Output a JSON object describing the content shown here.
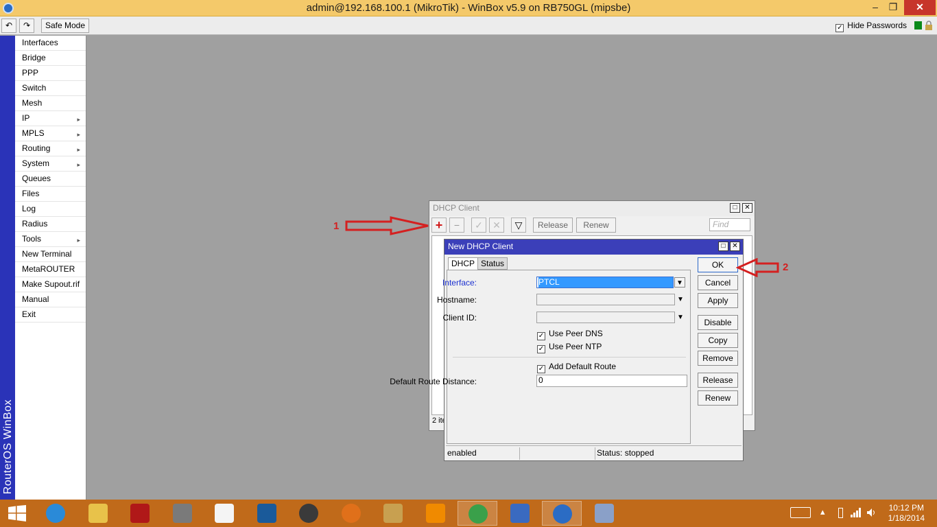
{
  "app": {
    "title": "admin@192.168.100.1 (MikroTik) - WinBox v5.9 on RB750GL (mipsbe)",
    "controls": {
      "minimize": "–",
      "maximize": "❐",
      "close": "✕"
    }
  },
  "toolbar": {
    "undo_glyph": "↶",
    "redo_glyph": "↷",
    "safe_mode": "Safe Mode",
    "hide_passwords": "Hide Passwords",
    "hide_passwords_checked": "✓"
  },
  "sidebar": {
    "vertical_label": "RouterOS WinBox",
    "items": [
      {
        "label": "Interfaces",
        "sub": ""
      },
      {
        "label": "Bridge",
        "sub": ""
      },
      {
        "label": "PPP",
        "sub": ""
      },
      {
        "label": "Switch",
        "sub": ""
      },
      {
        "label": "Mesh",
        "sub": ""
      },
      {
        "label": "IP",
        "sub": "▸"
      },
      {
        "label": "MPLS",
        "sub": "▸"
      },
      {
        "label": "Routing",
        "sub": "▸"
      },
      {
        "label": "System",
        "sub": "▸"
      },
      {
        "label": "Queues",
        "sub": ""
      },
      {
        "label": "Files",
        "sub": ""
      },
      {
        "label": "Log",
        "sub": ""
      },
      {
        "label": "Radius",
        "sub": ""
      },
      {
        "label": "Tools",
        "sub": "▸"
      },
      {
        "label": "New Terminal",
        "sub": ""
      },
      {
        "label": "MetaROUTER",
        "sub": ""
      },
      {
        "label": "Make Supout.rif",
        "sub": ""
      },
      {
        "label": "Manual",
        "sub": ""
      },
      {
        "label": "Exit",
        "sub": ""
      }
    ]
  },
  "dhcp_client": {
    "title": "DHCP Client",
    "add": "+",
    "remove": "−",
    "enable": "✓",
    "disable": "✕",
    "filter": "▽",
    "release": "Release",
    "renew": "Renew",
    "find_placeholder": "Find",
    "item_count": "2 ite"
  },
  "new_dhcp_client": {
    "title": "New DHCP Client",
    "tabs": [
      "DHCP",
      "Status"
    ],
    "fields": {
      "interface_label": "Interface:",
      "interface_value": "PTCL",
      "hostname_label": "Hostname:",
      "hostname_value": "",
      "client_id_label": "Client ID:",
      "client_id_value": "",
      "use_peer_dns": "Use Peer DNS",
      "use_peer_ntp": "Use Peer NTP",
      "add_default_route": "Add Default Route",
      "route_distance_label": "Default Route Distance:",
      "route_distance_value": "0",
      "check": "✓",
      "dropdown": "▼"
    },
    "buttons": [
      "OK",
      "Cancel",
      "Apply",
      "Disable",
      "Copy",
      "Remove",
      "Release",
      "Renew"
    ],
    "status": {
      "state": "enabled",
      "middle": "",
      "status": "Status: stopped"
    }
  },
  "annotations": {
    "one": "1",
    "two": "2",
    "color": "#d42020"
  },
  "taskbar": {
    "clock_time": "10:12 PM",
    "clock_date": "1/18/2014",
    "tray_up": "▴",
    "apps": [
      {
        "name": "internet-explorer",
        "color": "#2a8ad8"
      },
      {
        "name": "file-explorer",
        "color": "#e8c24a"
      },
      {
        "name": "power",
        "color": "#b01818"
      },
      {
        "name": "documents",
        "color": "#7a7a7a"
      },
      {
        "name": "amazon",
        "color": "#f4f4f4"
      },
      {
        "name": "settings",
        "color": "#1a5a9a"
      },
      {
        "name": "speaker",
        "color": "#3a3a3a"
      },
      {
        "name": "firefox",
        "color": "#e0701a"
      },
      {
        "name": "media",
        "color": "#c8a050"
      },
      {
        "name": "vlc",
        "color": "#f08a00"
      },
      {
        "name": "chrome",
        "color": "#3aa04a"
      },
      {
        "name": "network",
        "color": "#3a6ac0"
      },
      {
        "name": "winbox",
        "color": "#2b6cc4"
      },
      {
        "name": "paint",
        "color": "#8aa0c8"
      }
    ]
  }
}
